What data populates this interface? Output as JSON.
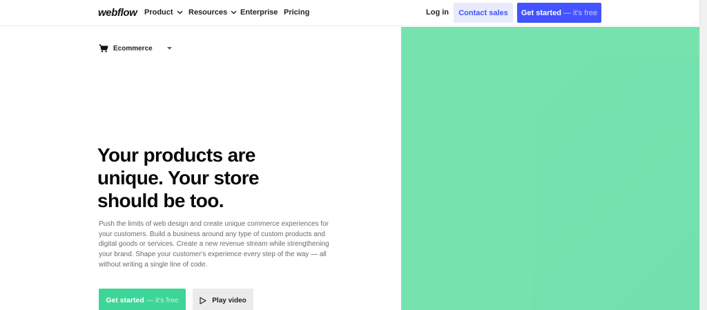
{
  "nav": {
    "logo": "webflow",
    "items": [
      {
        "label": "Product"
      },
      {
        "label": "Resources"
      },
      {
        "label": "Enterprise"
      },
      {
        "label": "Pricing"
      }
    ],
    "login": "Log in",
    "contact_sales": "Contact sales",
    "get_started": {
      "main": "Get started",
      "suffix": " — it's free"
    }
  },
  "breadcrumb": {
    "label": "Ecommerce",
    "icon": "cart-icon"
  },
  "hero": {
    "headline": "Your products are unique. Your store should be too.",
    "lead": "Push the limits of web design and create unique commerce experiences for your customers. Build a business around any type of custom products and digital goods or services. Create a new revenue stream while strengthening your brand. Shape your customer's experience every step of the way — all without writing a single line of code.",
    "cta_primary": {
      "main": "Get started",
      "suffix": " — it's free"
    },
    "cta_video": "Play video",
    "panel_color": "#76e3ae"
  },
  "colors": {
    "accent": "#4353ff",
    "accent_light": "#e8ebfc",
    "green": "#3ed598"
  }
}
